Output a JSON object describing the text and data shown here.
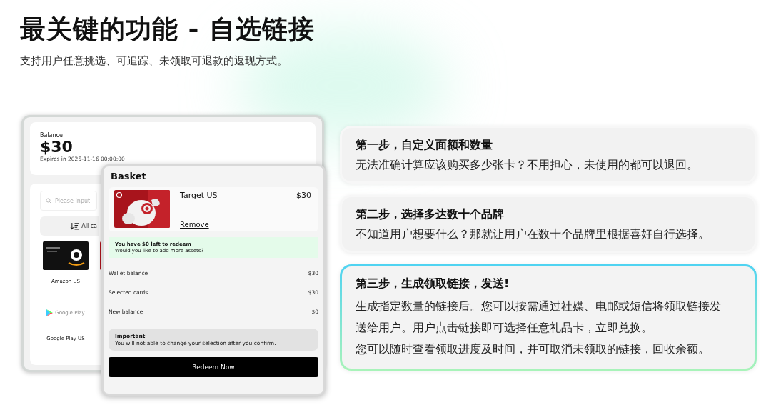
{
  "heading": {
    "title": "最关键的功能 - 自选链接",
    "subtitle": "支持用户任意挑选、可追踪、未领取可退款的返现方式。"
  },
  "wallet": {
    "balance_label": "Balance",
    "balance": "$30",
    "expiry": "Expires in 2025-11-16 00:00:00",
    "search": {
      "placeholder": "Please Input"
    },
    "sort_button": "All ca",
    "cards": [
      {
        "kind": "amazon",
        "name": "Amazon US"
      },
      {
        "kind": "target"
      },
      {
        "kind": "google_play",
        "logo_text": "Google Play",
        "name": "Google Play US"
      }
    ]
  },
  "basket": {
    "title": "Basket",
    "item": {
      "name": "Target US",
      "price": "$30",
      "remove": "Remove"
    },
    "notice": {
      "title": "You have $0 left to redeem",
      "text": "Would you like to add more assets?"
    },
    "summary": [
      {
        "label": "Wallet balance",
        "value": "$30"
      },
      {
        "label": "Selected cards",
        "value": "$30"
      },
      {
        "label": "New balance",
        "value": "$0"
      }
    ],
    "warning": {
      "title": "Important",
      "text": "You will not able to change your selection after you confirm."
    },
    "button": "Redeem Now"
  },
  "steps": [
    {
      "title": "第一步，自定义面额和数量",
      "paragraphs": [
        "无法准确计算应该购买多少张卡？不用担心，未使用的都可以退回。"
      ],
      "selected": false
    },
    {
      "title": "第二步，选择多达数十个品牌",
      "paragraphs": [
        "不知道用户想要什么？那就让用户在数十个品牌里根据喜好自行选择。"
      ],
      "selected": false
    },
    {
      "title": "第三步，生成领取链接，发送!",
      "paragraphs": [
        "生成指定数量的链接后。您可以按需通过社媒、电邮或短信将领取链接发",
        "送给用户。用户点击链接即可选择任意礼品卡，立即兑换。",
        "您可以随时查看领取进度及时间，并可取消未领取的链接，回收余额。"
      ],
      "selected": true
    }
  ]
}
